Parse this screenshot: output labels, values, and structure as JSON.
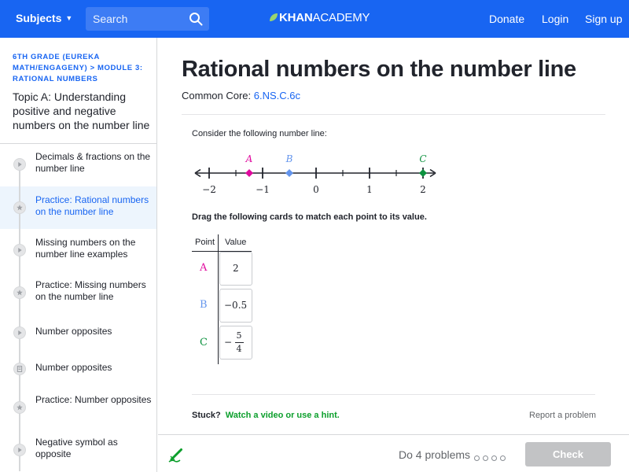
{
  "header": {
    "subjects_label": "Subjects",
    "search_placeholder": "Search",
    "logo_bold": "KHAN",
    "logo_rest": "ACADEMY",
    "donate": "Donate",
    "login": "Login",
    "signup": "Sign up",
    "color": "#1865f2"
  },
  "sidebar": {
    "crumb_1": "6TH GRADE (EUREKA MATH/ENGAGENY)",
    "crumb_sep": ">",
    "crumb_2": "MODULE 3: RATIONAL NUMBERS",
    "topic": "Topic A: Understanding positive and negative numbers on the number line",
    "items": [
      {
        "label": "Decimals & fractions on the number line",
        "icon": "play-icon"
      },
      {
        "label": "Practice: Rational numbers on the number line",
        "icon": "star-icon",
        "active": true
      },
      {
        "label": "Missing numbers on the number line examples",
        "icon": "play-icon"
      },
      {
        "label": "Practice: Missing numbers on the number line",
        "icon": "star-icon"
      },
      {
        "label": "Number opposites",
        "icon": "play-icon"
      },
      {
        "label": "Number opposites",
        "icon": "article-icon"
      },
      {
        "label": "Practice: Number opposites",
        "icon": "star-icon"
      },
      {
        "label": "Negative symbol as opposite",
        "icon": "play-icon"
      }
    ]
  },
  "main": {
    "title": "Rational numbers on the number line",
    "common_core_label": "Common Core:",
    "common_core_code": "6.NS.C.6c",
    "prompt": "Consider the following number line:",
    "number_line": {
      "tick_labels": [
        "−2",
        "−1",
        "0",
        "1",
        "2"
      ],
      "points": [
        {
          "name": "A",
          "value": -1.25,
          "color": "#e00a9e"
        },
        {
          "name": "B",
          "value": -0.5,
          "color": "#6495ed"
        },
        {
          "name": "C",
          "value": 2,
          "color": "#0d923f"
        }
      ]
    },
    "instruction": "Drag the following cards to match each point to its value.",
    "table": {
      "col_point": "Point",
      "col_value": "Value",
      "rows": [
        {
          "point": "A",
          "value": "2"
        },
        {
          "point": "B",
          "value": "−0.5"
        },
        {
          "point": "C",
          "value_sign": "−",
          "numerator": "5",
          "denominator": "4"
        }
      ]
    },
    "stuck_label": "Stuck?",
    "hint_link": "Watch a video or use a hint.",
    "report": "Report a problem"
  },
  "footer": {
    "progress_text": "Do 4 problems",
    "dots": 4,
    "check_label": "Check"
  }
}
